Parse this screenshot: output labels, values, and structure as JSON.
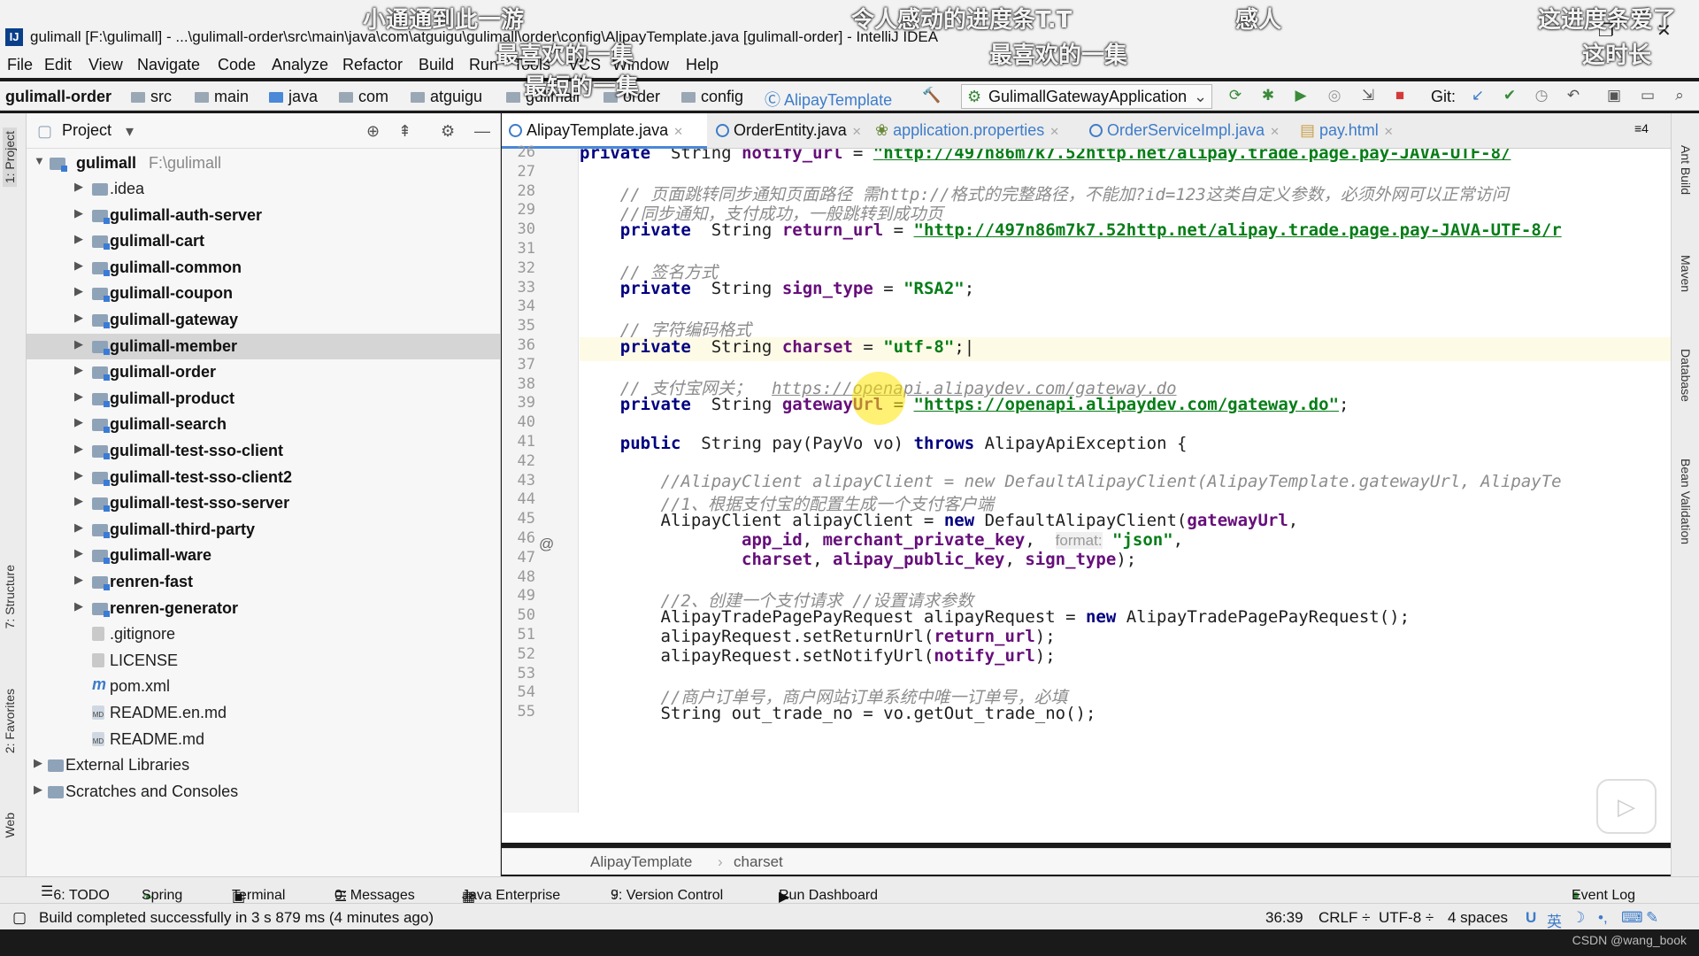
{
  "window": {
    "title": "gulimall [F:\\gulimall] - ...\\gulimall-order\\src\\main\\java\\com\\atguigu\\gulimall\\order\\config\\AlipayTemplate.java [gulimall-order] - IntelliJ IDEA"
  },
  "overlays": {
    "o1": "小通通到此一游",
    "o2": "令人感动的进度条T.T",
    "o3": "感人",
    "o4": "这进度条爱了",
    "o5": "最喜欢的一集",
    "o6": "最喜欢的一集",
    "o7": "这时长",
    "o8": "最短的一集"
  },
  "menu": [
    "File",
    "Edit",
    "View",
    "Navigate",
    "Code",
    "Analyze",
    "Refactor",
    "Build",
    "Run",
    "Tools",
    "VCS",
    "Window",
    "Help"
  ],
  "breadcrumbs": [
    "gulimall-order",
    "src",
    "main",
    "java",
    "com",
    "atguigu",
    "gulimall",
    "order",
    "config",
    "AlipayTemplate"
  ],
  "toolbar": {
    "run_config": "GulimallGatewayApplication",
    "git_label": "Git:"
  },
  "left_tabs": {
    "project": "1: Project",
    "structure": "7: Structure",
    "favorites": "2: Favorites",
    "web": "Web"
  },
  "right_tabs": {
    "ant": "Ant Build",
    "maven": "Maven",
    "database": "Database",
    "bean": "Bean Validation"
  },
  "project_panel": {
    "title": "Project",
    "root_name": "gulimall",
    "root_path": "F:\\gulimall",
    "items": [
      ".idea",
      "gulimall-auth-server",
      "gulimall-cart",
      "gulimall-common",
      "gulimall-coupon",
      "gulimall-gateway",
      "gulimall-member",
      "gulimall-order",
      "gulimall-product",
      "gulimall-search",
      "gulimall-test-sso-client",
      "gulimall-test-sso-client2",
      "gulimall-test-sso-server",
      "gulimall-third-party",
      "gulimall-ware",
      "renren-fast",
      "renren-generator",
      ".gitignore",
      "LICENSE",
      "pom.xml",
      "README.en.md",
      "README.md",
      "External Libraries",
      "Scratches and Consoles"
    ],
    "selected": "gulimall-member",
    "md_badge": "MD",
    "maven_badge": "m"
  },
  "editor_tabs": [
    "AlipayTemplate.java",
    "OrderEntity.java",
    "application.properties",
    "OrderServiceImpl.java",
    "pay.html"
  ],
  "editor_tabs_overflow": "≡4",
  "line_numbers": [
    "26",
    "27",
    "28",
    "29",
    "30",
    "31",
    "32",
    "33",
    "34",
    "35",
    "36",
    "37",
    "38",
    "39",
    "40",
    "41",
    "42",
    "43",
    "44",
    "45",
    "46",
    "47",
    "48",
    "49",
    "50",
    "51",
    "52",
    "53",
    "54",
    "55"
  ],
  "code": {
    "private": "private",
    "public": "public",
    "new": "new",
    "throws": "throws",
    "string": "String",
    "l26_field": "notify_url",
    "l26_url": "http://497n86m7k7.52http.net/alipay.trade.page.pay-JAVA-UTF-8/",
    "l28": "// 页面跳转同步通知页面路径 需http://格式的完整路径，不能加?id=123这类自定义参数，必须外网可以正常访问",
    "l29": "//同步通知，支付成功，一般跳转到成功页",
    "l30_field": "return_url",
    "l30_url": "http://497n86m7k7.52http.net/alipay.trade.page.pay-JAVA-UTF-8/r",
    "l32": "// 签名方式",
    "l33_field": "sign_type",
    "l33_val": "\"RSA2\"",
    "l35": "// 字符编码格式",
    "l36_field": "charset",
    "l36_val": "\"utf-8\"",
    "l38_cmt": "// 支付宝网关；",
    "l38_url": "https://openapi.alipaydev.com/gateway.do",
    "l39_field": "gatewayUrl",
    "l39_url": "https://openapi.alipaydev.com/gateway.do",
    "l41_sig": "pay(PayVo vo)",
    "l41_exc": "AlipayApiException {",
    "l43": "//AlipayClient alipayClient = new DefaultAlipayClient(AlipayTemplate.gatewayUrl, AlipayTe",
    "l44": "//1、根据支付宝的配置生成一个支付客户端",
    "l45_a": "AlipayClient alipayClient = ",
    "l45_b": "DefaultAlipayClient(",
    "l46_a": "app_id",
    "l46_b": "merchant_private_key",
    "l46_hint": "format:",
    "l46_val": "\"json\"",
    "l47_a": "charset",
    "l47_b": "alipay_public_key",
    "l47_c": "sign_type",
    "l49": "//2、创建一个支付请求 //设置请求参数",
    "l50_a": "AlipayTradePagePayRequest alipayRequest = ",
    "l50_b": "AlipayTradePagePayRequest();",
    "l51_a": "alipayRequest.setReturnUrl(",
    "l52_a": "alipayRequest.setNotifyUrl(",
    "l54": "//商户订单号，商户网站订单系统中唯一订单号，必填",
    "l55": "String out_trade_no = vo.getOut_trade_no();"
  },
  "editor_breadcrumb": [
    "AlipayTemplate",
    "charset"
  ],
  "bottom_tools": [
    "6: TODO",
    "Spring",
    "Terminal",
    "0: Messages",
    "Java Enterprise",
    "9: Version Control",
    "Run Dashboard",
    "Event Log"
  ],
  "status": {
    "message": "Build completed successfully in 3 s 879 ms (4 minutes ago)",
    "position": "36:39",
    "line_sep": "CRLF ÷",
    "encoding": "UTF-8 ÷",
    "indent": "4 spaces",
    "ime": "英"
  },
  "credit": "CSDN @wang_book",
  "colors": {
    "keyword": "#000080",
    "field": "#660e7a",
    "string": "#067d17",
    "comment": "#8c8c8c",
    "accent": "#4a88d8"
  }
}
